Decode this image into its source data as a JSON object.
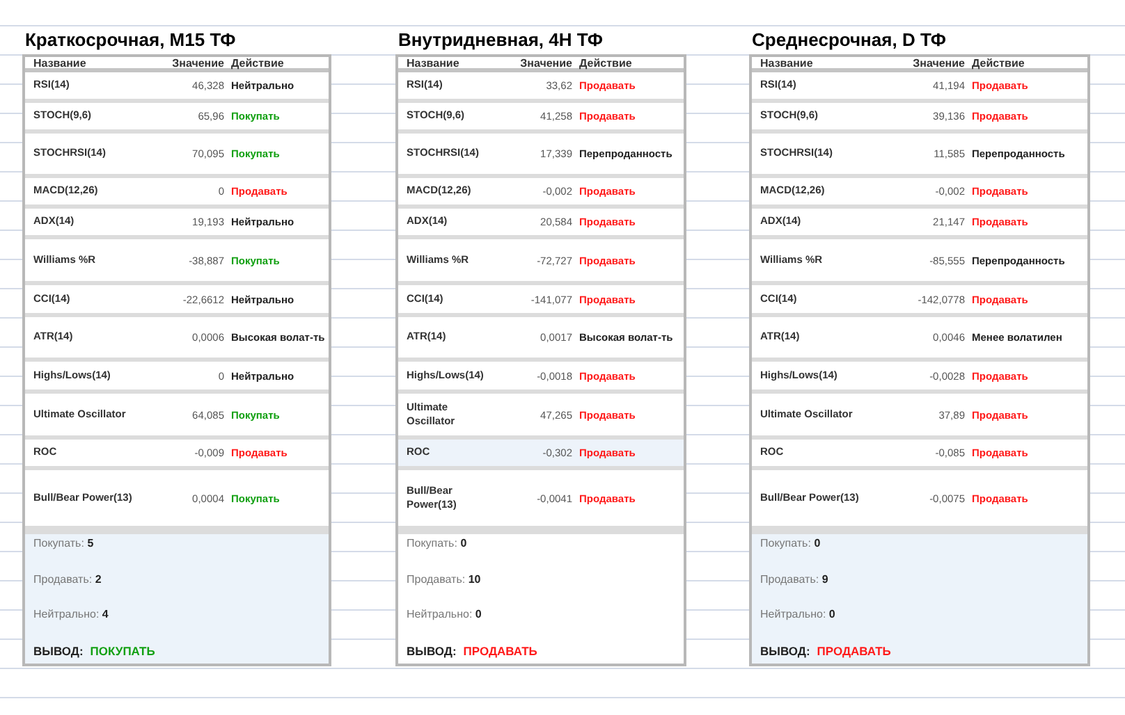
{
  "panels": [
    {
      "title": "Краткосрочная, M15 ТФ",
      "columns": [
        "Название",
        "Значение",
        "Действие"
      ],
      "rows": [
        {
          "name": "RSI(14)",
          "value": "46,328",
          "action": "Нейтрально",
          "kind": "neutral",
          "selected": false
        },
        {
          "name": "STOCH(9,6)",
          "value": "65,96",
          "action": "Покупать",
          "kind": "buy",
          "selected": false
        },
        {
          "name": "STOCHRSI(14)",
          "value": "70,095",
          "action": "Покупать",
          "kind": "buy",
          "selected": false
        },
        {
          "name": "MACD(12,26)",
          "value": "0",
          "action": "Продавать",
          "kind": "sell",
          "selected": false
        },
        {
          "name": "ADX(14)",
          "value": "19,193",
          "action": "Нейтрально",
          "kind": "neutral",
          "selected": false
        },
        {
          "name": "Williams %R",
          "value": "-38,887",
          "action": "Покупать",
          "kind": "buy",
          "selected": false
        },
        {
          "name": "CCI(14)",
          "value": "-22,6612",
          "action": "Нейтрально",
          "kind": "neutral",
          "selected": false
        },
        {
          "name": "ATR(14)",
          "value": "0,0006",
          "action": "Высокая волат-ть",
          "kind": "neutral",
          "selected": false
        },
        {
          "name": "Highs/Lows(14)",
          "value": "0",
          "action": "Нейтрально",
          "kind": "neutral",
          "selected": false
        },
        {
          "name": "Ultimate Oscillator",
          "value": "64,085",
          "action": "Покупать",
          "kind": "buy",
          "selected": false
        },
        {
          "name": "ROC",
          "value": "-0,009",
          "action": "Продавать",
          "kind": "sell",
          "selected": false
        },
        {
          "name": "Bull/Bear Power(13)",
          "value": "0,0004",
          "action": "Покупать",
          "kind": "buy",
          "selected": false
        }
      ],
      "summary": {
        "shaded": true,
        "counts": [
          {
            "label": "Покупать:",
            "value": "5"
          },
          {
            "label": "Продавать:",
            "value": "2"
          },
          {
            "label": "Нейтрально:",
            "value": "4"
          }
        ],
        "verdict_label": "ВЫВОД:",
        "verdict": "ПОКУПАТЬ",
        "kind": "buy"
      }
    },
    {
      "title": "Внутридневная, 4H ТФ",
      "columns": [
        "Название",
        "Значение",
        "Действие"
      ],
      "rows": [
        {
          "name": "RSI(14)",
          "value": "33,62",
          "action": "Продавать",
          "kind": "sell",
          "selected": false
        },
        {
          "name": "STOCH(9,6)",
          "value": "41,258",
          "action": "Продавать",
          "kind": "sell",
          "selected": false
        },
        {
          "name": "STOCHRSI(14)",
          "value": "17,339",
          "action": "Перепроданность",
          "kind": "neutral",
          "selected": false
        },
        {
          "name": "MACD(12,26)",
          "value": "-0,002",
          "action": "Продавать",
          "kind": "sell",
          "selected": false
        },
        {
          "name": "ADX(14)",
          "value": "20,584",
          "action": "Продавать",
          "kind": "sell",
          "selected": false
        },
        {
          "name": "Williams %R",
          "value": "-72,727",
          "action": "Продавать",
          "kind": "sell",
          "selected": false
        },
        {
          "name": "CCI(14)",
          "value": "-141,077",
          "action": "Продавать",
          "kind": "sell",
          "selected": false
        },
        {
          "name": "ATR(14)",
          "value": "0,0017",
          "action": "Высокая волат-ть",
          "kind": "neutral",
          "selected": false
        },
        {
          "name": "Highs/Lows(14)",
          "value": "-0,0018",
          "action": "Продавать",
          "kind": "sell",
          "selected": false
        },
        {
          "name": "Ultimate Oscillator",
          "value": "47,265",
          "action": "Продавать",
          "kind": "sell",
          "selected": false
        },
        {
          "name": "ROC",
          "value": "-0,302",
          "action": "Продавать",
          "kind": "sell",
          "selected": true
        },
        {
          "name": "Bull/Bear Power(13)",
          "value": "-0,0041",
          "action": "Продавать",
          "kind": "sell",
          "selected": false
        }
      ],
      "summary": {
        "shaded": false,
        "counts": [
          {
            "label": "Покупать:",
            "value": "0"
          },
          {
            "label": "Продавать:",
            "value": "10"
          },
          {
            "label": "Нейтрально:",
            "value": "0"
          }
        ],
        "verdict_label": "ВЫВОД:",
        "verdict": "ПРОДАВАТЬ",
        "kind": "sell"
      }
    },
    {
      "title": "Среднесрочная, D ТФ",
      "columns": [
        "Название",
        "Значение",
        "Действие"
      ],
      "rows": [
        {
          "name": "RSI(14)",
          "value": "41,194",
          "action": "Продавать",
          "kind": "sell",
          "selected": false
        },
        {
          "name": "STOCH(9,6)",
          "value": "39,136",
          "action": "Продавать",
          "kind": "sell",
          "selected": false
        },
        {
          "name": "STOCHRSI(14)",
          "value": "11,585",
          "action": "Перепроданность",
          "kind": "neutral",
          "selected": false
        },
        {
          "name": "MACD(12,26)",
          "value": "-0,002",
          "action": "Продавать",
          "kind": "sell",
          "selected": false
        },
        {
          "name": "ADX(14)",
          "value": "21,147",
          "action": "Продавать",
          "kind": "sell",
          "selected": false
        },
        {
          "name": "Williams %R",
          "value": "-85,555",
          "action": "Перепроданность",
          "kind": "neutral",
          "selected": false
        },
        {
          "name": "CCI(14)",
          "value": "-142,0778",
          "action": "Продавать",
          "kind": "sell",
          "selected": false
        },
        {
          "name": "ATR(14)",
          "value": "0,0046",
          "action": "Менее волатилен",
          "kind": "neutral",
          "selected": false
        },
        {
          "name": "Highs/Lows(14)",
          "value": "-0,0028",
          "action": "Продавать",
          "kind": "sell",
          "selected": false
        },
        {
          "name": "Ultimate Oscillator",
          "value": "37,89",
          "action": "Продавать",
          "kind": "sell",
          "selected": false
        },
        {
          "name": "ROC",
          "value": "-0,085",
          "action": "Продавать",
          "kind": "sell",
          "selected": false
        },
        {
          "name": "Bull/Bear Power(13)",
          "value": "-0,0075",
          "action": "Продавать",
          "kind": "sell",
          "selected": false
        }
      ],
      "summary": {
        "shaded": true,
        "counts": [
          {
            "label": "Покупать:",
            "value": "0"
          },
          {
            "label": "Продавать:",
            "value": "9"
          },
          {
            "label": "Нейтрально:",
            "value": "0"
          }
        ],
        "verdict_label": "ВЫВОД:",
        "verdict": "ПРОДАВАТЬ",
        "kind": "sell"
      }
    }
  ]
}
